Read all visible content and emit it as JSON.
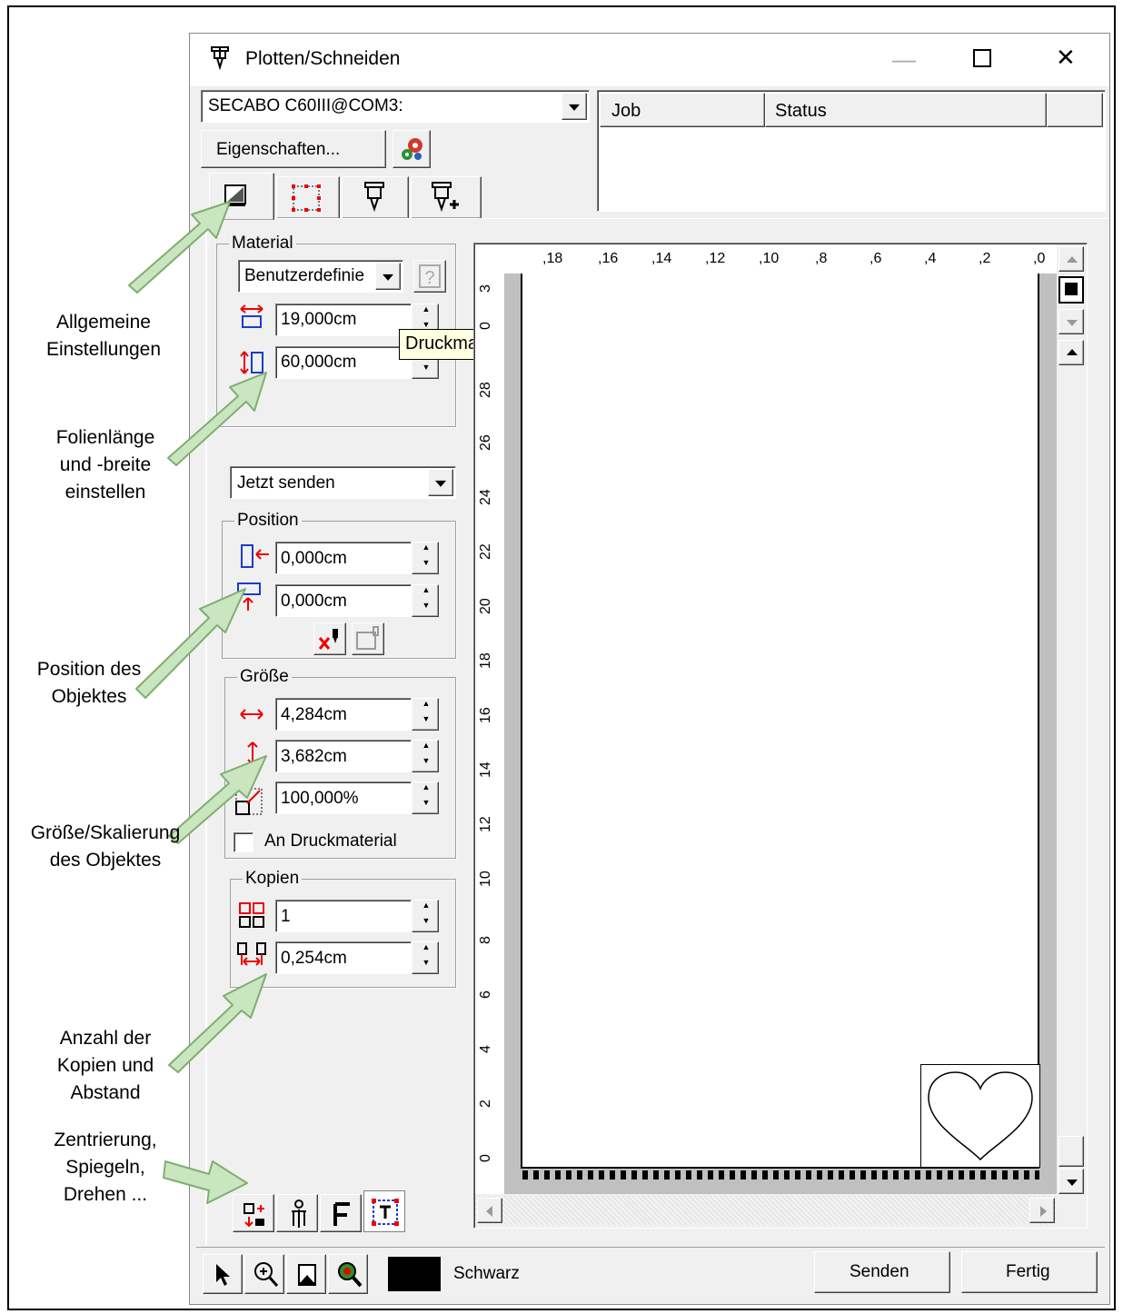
{
  "window": {
    "title": "Plotten/Schneiden",
    "controls": {
      "minimize": "—",
      "maximize": "☐",
      "close": "✕"
    }
  },
  "device": {
    "selected": "SECABO C60III@COM3:",
    "properties_label": "Eigenschaften..."
  },
  "job_table": {
    "columns": [
      "Job",
      "Status"
    ],
    "rows": []
  },
  "tabs": [
    "general-settings",
    "object-bounds",
    "plotter-tool",
    "plotter-tool-add"
  ],
  "material": {
    "group_label": "Material",
    "type": "Benutzerdefinie",
    "width": "19,000cm",
    "length": "60,000cm",
    "tooltip": "Druckmaterialbreite"
  },
  "send_mode": "Jetzt senden",
  "position": {
    "group_label": "Position",
    "x": "0,000cm",
    "y": "0,000cm"
  },
  "size": {
    "group_label": "Größe",
    "width": "4,284cm",
    "height": "3,682cm",
    "scale": "100,000%",
    "fit_label": "An Druckmaterial"
  },
  "copies": {
    "group_label": "Kopien",
    "count": "1",
    "spacing": "0,254cm"
  },
  "ruler": {
    "top": [
      ",18",
      ",16",
      ",14",
      ",12",
      ",10",
      ",8",
      ",6",
      ",4",
      ",2",
      ",0"
    ],
    "left": [
      "3",
      "0",
      "28",
      "26",
      "24",
      "22",
      "20",
      "18",
      "16",
      "14",
      "12",
      "10",
      "8",
      "6",
      "4",
      "2",
      "0"
    ]
  },
  "bottom_bar": {
    "color_label": "Schwarz",
    "color_value": "#000000",
    "send_label": "Senden",
    "done_label": "Fertig"
  },
  "bottom_tools": [
    "center-icon",
    "mirror-icon",
    "font-icon",
    "text-frame-icon"
  ],
  "annotations": {
    "general": [
      "Allgemeine",
      "Einstellungen"
    ],
    "foil": [
      "Folienlänge",
      "und -breite",
      "einstellen"
    ],
    "position": [
      "Position des",
      "Objektes"
    ],
    "size": [
      "Größe/Skalierung",
      "des Objektes"
    ],
    "copies": [
      "Anzahl der",
      "Kopien und",
      "Abstand"
    ],
    "transform": [
      "Zentrierung,",
      "Spiegeln,",
      "Drehen ..."
    ]
  },
  "colors": {
    "arrow_fill": "#c9e6c0",
    "arrow_stroke": "#7fae6f",
    "window_bg": "#f0f0f0"
  }
}
